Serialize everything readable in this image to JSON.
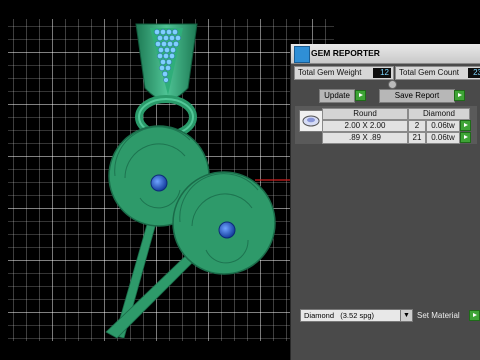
{
  "viewport": {
    "grid": true,
    "colors": {
      "grid": "#d8d8d8",
      "model": "#2e9a6a",
      "gem": "#1f4fb8",
      "accent_line": "#d02020"
    }
  },
  "panel": {
    "title": "GEM REPORTER",
    "total_weight_label": "Total Gem Weight",
    "total_weight_value": "12",
    "total_count_label": "Total Gem Count",
    "total_count_value": "23",
    "update_label": "Update",
    "save_report_label": "Save Report",
    "table": {
      "headers": [
        "Round",
        "Diamond"
      ],
      "rows": [
        {
          "size": "2.00 X 2.00",
          "count": "2",
          "weight": "0.06tw"
        },
        {
          "size": ".89 X .89",
          "count": "21",
          "weight": "0.06tw"
        }
      ]
    },
    "material_select": "Diamond   (3.52 spg)",
    "set_material_label": "Set Material"
  }
}
